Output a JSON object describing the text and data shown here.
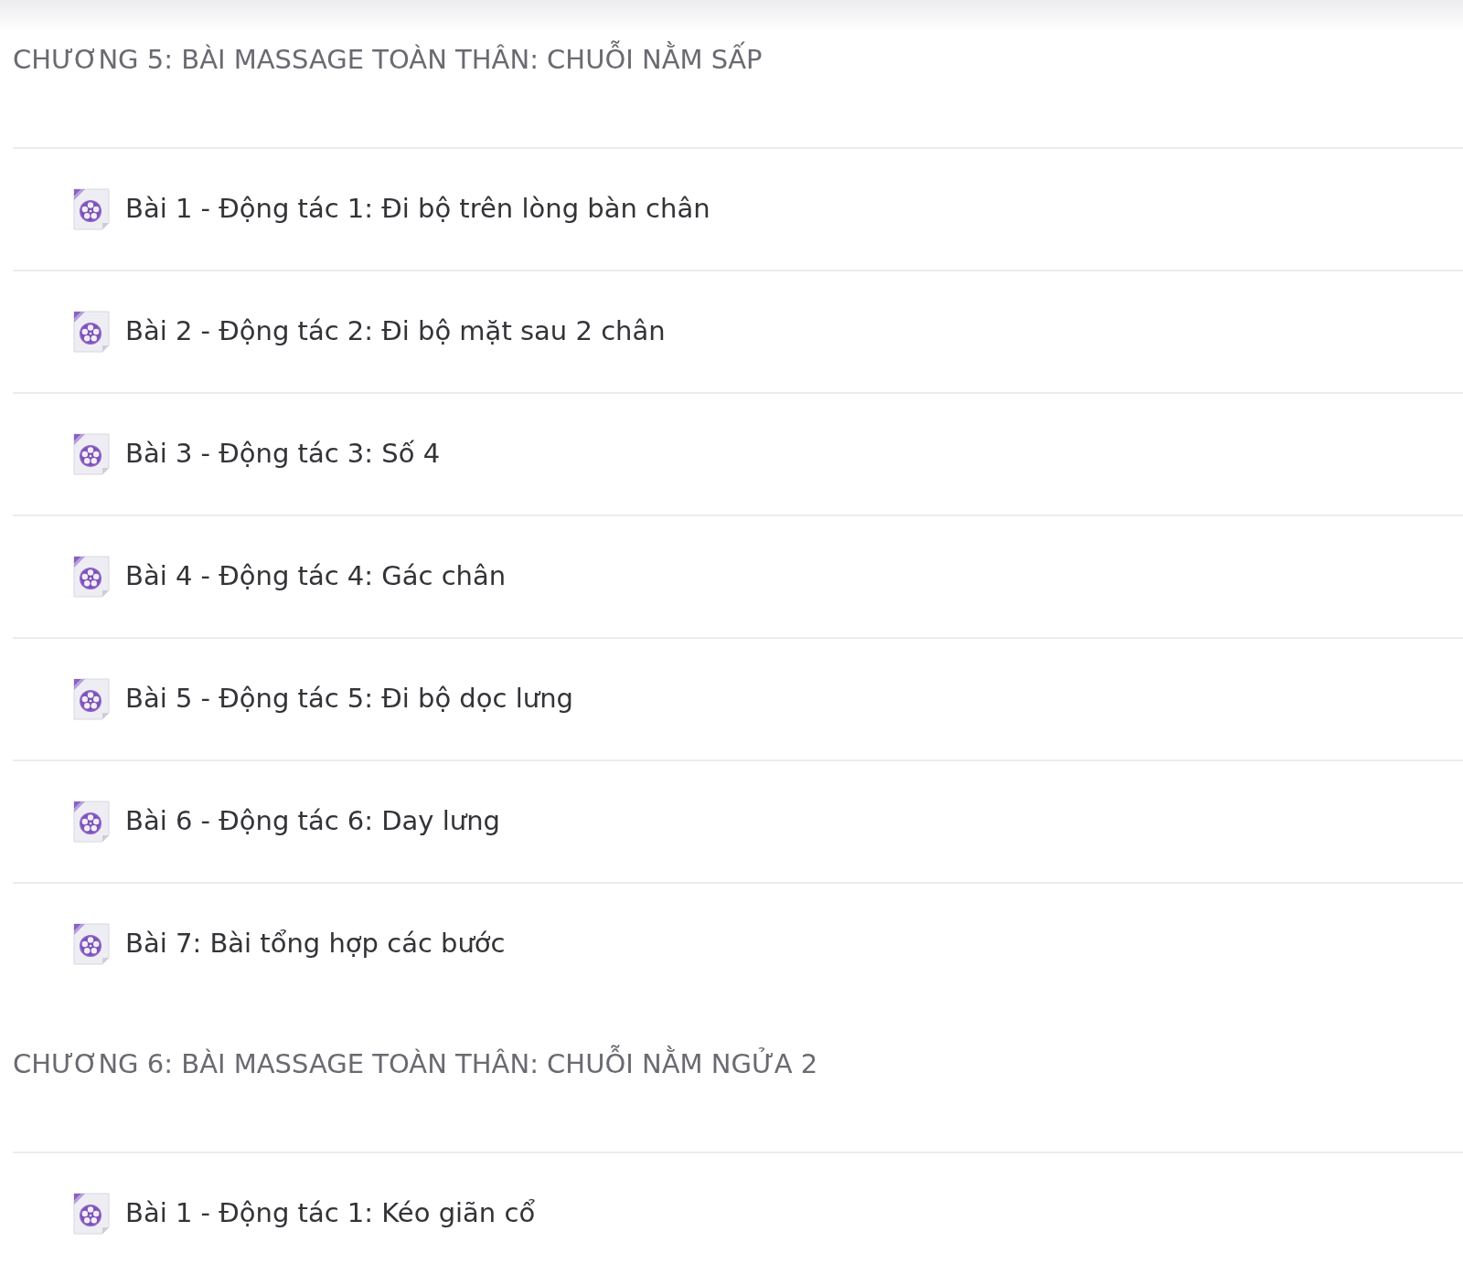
{
  "chapters": [
    {
      "title": "CHƯƠNG 5: BÀI MASSAGE TOÀN THÂN: CHUỖI NẰM SẤP",
      "lessons": [
        {
          "title": "Bài 1 - Động tác 1: Đi bộ trên lòng bàn chân"
        },
        {
          "title": "Bài 2 - Động tác 2: Đi bộ mặt sau 2 chân"
        },
        {
          "title": "Bài 3 - Động tác 3: Số 4"
        },
        {
          "title": "Bài 4 - Động tác 4: Gác chân"
        },
        {
          "title": "Bài 5 - Động tác 5: Đi bộ dọc lưng"
        },
        {
          "title": "Bài 6 - Động tác 6: Day lưng"
        },
        {
          "title": "Bài 7: Bài tổng hợp các bước"
        }
      ]
    },
    {
      "title": "CHƯƠNG 6: BÀI MASSAGE TOÀN THÂN: CHUỖI NẰM NGỬA 2",
      "lessons": [
        {
          "title": "Bài 1 - Động tác 1: Kéo giãn cổ"
        }
      ]
    }
  ]
}
